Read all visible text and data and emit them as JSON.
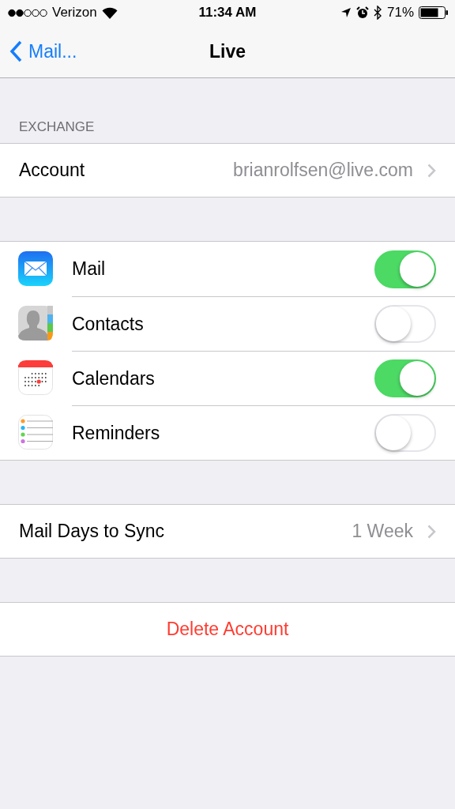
{
  "status_bar": {
    "carrier": "Verizon",
    "time": "11:34 AM",
    "battery": "71%"
  },
  "nav": {
    "back": "Mail...",
    "title": "Live"
  },
  "section_header": "EXCHANGE",
  "account": {
    "label": "Account",
    "value": "brianrolfsen@live.com"
  },
  "services": [
    {
      "kind": "mail",
      "label": "Mail",
      "on": true
    },
    {
      "kind": "contacts",
      "label": "Contacts",
      "on": false
    },
    {
      "kind": "calendars",
      "label": "Calendars",
      "on": true
    },
    {
      "kind": "reminders",
      "label": "Reminders",
      "on": false
    }
  ],
  "sync": {
    "label": "Mail Days to Sync",
    "value": "1 Week"
  },
  "delete_button": "Delete Account"
}
